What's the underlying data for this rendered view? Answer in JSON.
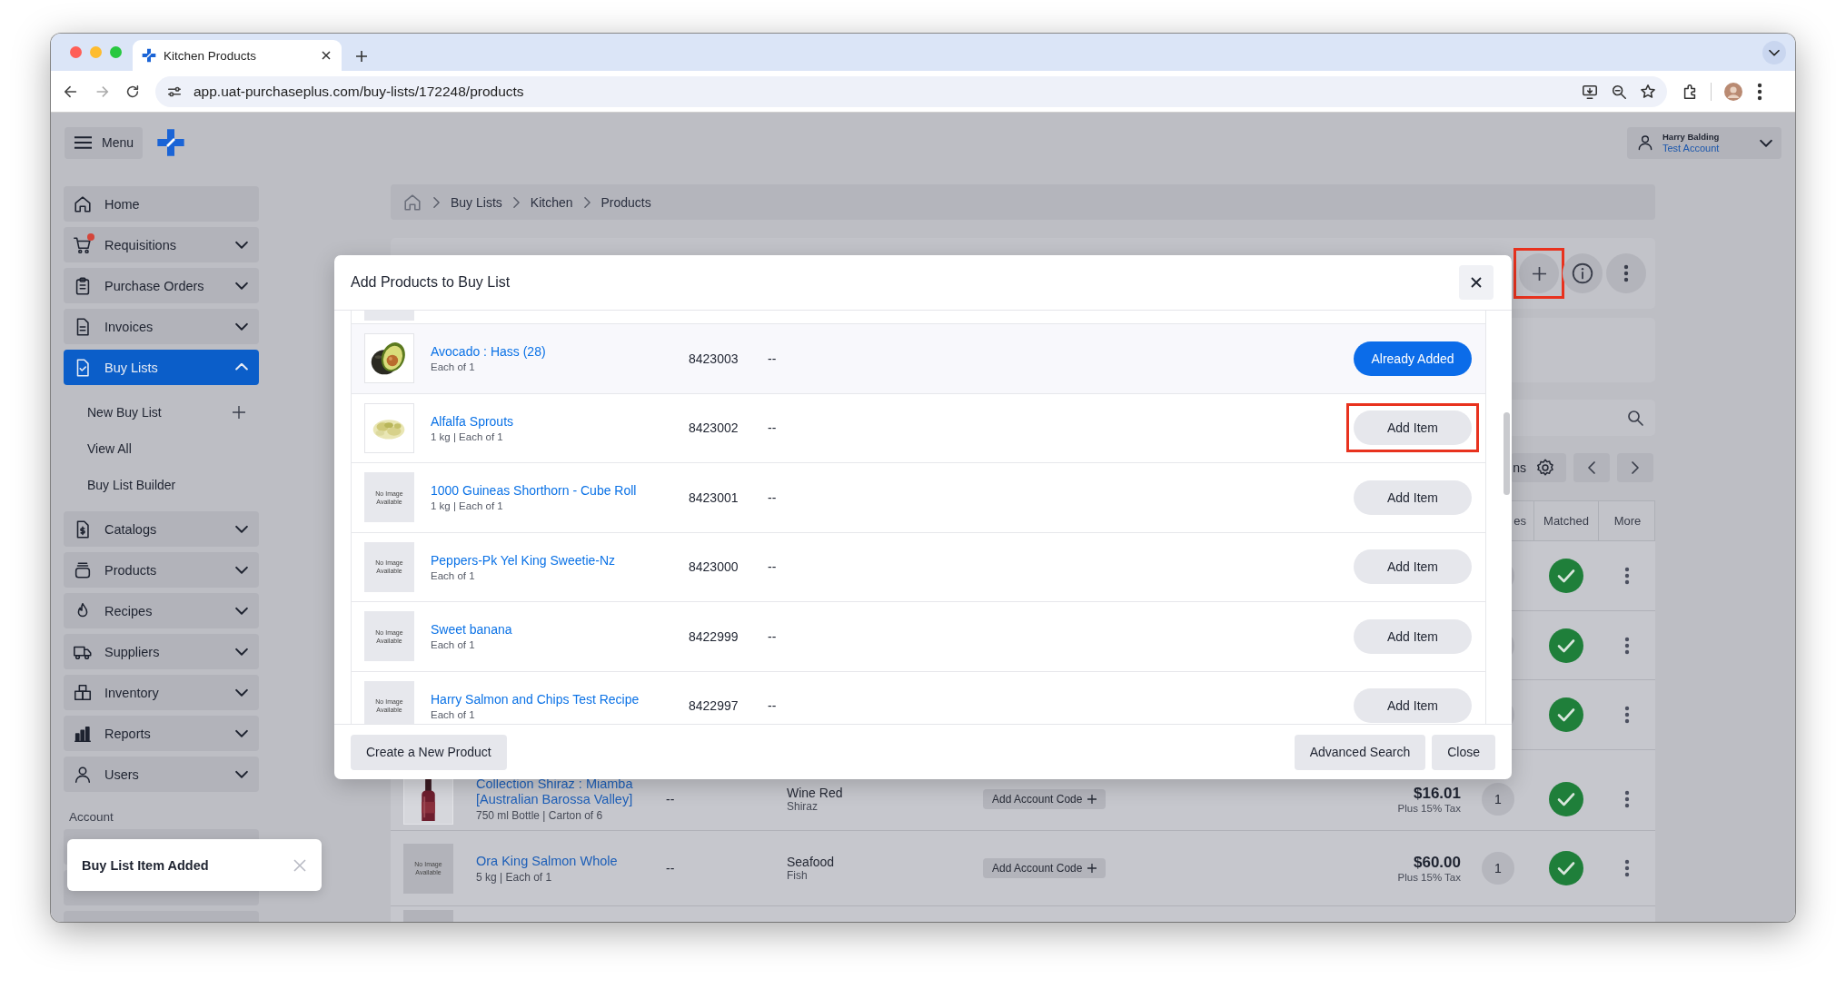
{
  "browser": {
    "tab_title": "Kitchen Products",
    "url": "app.uat-purchaseplus.com/buy-lists/172248/products"
  },
  "header": {
    "menu_label": "Menu",
    "user_name": "Harry Balding",
    "account_name": "Test Account"
  },
  "sidebar": {
    "items": [
      {
        "label": "Home",
        "kind": "link",
        "selected": false,
        "notification": false
      },
      {
        "label": "Requisitions",
        "kind": "group",
        "selected": false,
        "expanded": false,
        "notification": true
      },
      {
        "label": "Purchase Orders",
        "kind": "group",
        "selected": false,
        "expanded": false,
        "notification": false
      },
      {
        "label": "Invoices",
        "kind": "group",
        "selected": false,
        "expanded": false,
        "notification": false
      },
      {
        "label": "Buy Lists",
        "kind": "group",
        "selected": true,
        "expanded": true,
        "notification": false,
        "children": [
          {
            "label": "New Buy List",
            "kind": "add"
          },
          {
            "label": "View All",
            "kind": "link"
          },
          {
            "label": "Buy List Builder",
            "kind": "link"
          }
        ]
      },
      {
        "label": "Catalogs",
        "kind": "group",
        "selected": false,
        "expanded": false,
        "notification": false
      },
      {
        "label": "Products",
        "kind": "group",
        "selected": false,
        "expanded": false,
        "notification": false
      },
      {
        "label": "Recipes",
        "kind": "group",
        "selected": false,
        "expanded": false,
        "notification": false
      },
      {
        "label": "Suppliers",
        "kind": "group",
        "selected": false,
        "expanded": false,
        "notification": false
      },
      {
        "label": "Inventory",
        "kind": "group",
        "selected": false,
        "expanded": false,
        "notification": false
      },
      {
        "label": "Reports",
        "kind": "group",
        "selected": false,
        "expanded": false,
        "notification": false
      },
      {
        "label": "Users",
        "kind": "group",
        "selected": false,
        "expanded": false,
        "notification": false
      }
    ],
    "section_label": "Account"
  },
  "breadcrumb": [
    "Buy Lists",
    "Kitchen",
    "Products"
  ],
  "page": {
    "add_button_highlighted": true,
    "columns_button": "ns",
    "table": {
      "columns": [
        "es",
        "Matched",
        "More"
      ],
      "rows": [
        {
          "kind": "covered",
          "matched": true
        },
        {
          "kind": "covered",
          "matched": true
        },
        {
          "kind": "covered",
          "matched": true
        },
        {
          "kind": "full",
          "name": "Collection Shiraz : Miamba [Australian Barossa Valley]",
          "details": "750 ml Bottle | Carton of 6",
          "code": "--",
          "category": "Wine Red",
          "subcategory": "Shiraz",
          "account_code": "Add Account Code",
          "price": "$16.01",
          "tax": "Plus 15% Tax",
          "quantity": "1",
          "matched": true
        },
        {
          "kind": "full",
          "image": {
            "kind": "placeholder",
            "text": "No Image Available"
          },
          "name": "Ora King Salmon Whole",
          "details": "5 kg | Each of 1",
          "code": "--",
          "category": "Seafood",
          "subcategory": "Fish",
          "account_code": "Add Account Code",
          "price": "$60.00",
          "tax": "Plus 15% Tax",
          "quantity": "1",
          "matched": true
        }
      ]
    }
  },
  "modal": {
    "title": "Add Products to Buy List",
    "items": [
      {
        "name": "Avocado : Hass (28)",
        "details": "Each of 1",
        "code": "8423003",
        "extra": "--",
        "action": "Already Added",
        "added": true,
        "highlighted": false
      },
      {
        "name": "Alfalfa Sprouts",
        "details": "1 kg | Each of 1",
        "code": "8423002",
        "extra": "--",
        "action": "Add Item",
        "added": false,
        "highlighted": true
      },
      {
        "image": {
          "kind": "placeholder",
          "text": "No Image Available"
        },
        "name": "1000 Guineas Shorthorn - Cube Roll",
        "details": "1 kg | Each of 1",
        "code": "8423001",
        "extra": "--",
        "action": "Add Item",
        "added": false,
        "highlighted": false
      },
      {
        "image": {
          "kind": "placeholder",
          "text": "No Image Available"
        },
        "name": "Peppers-Pk Yel King Sweetie-Nz",
        "details": "Each of 1",
        "code": "8423000",
        "extra": "--",
        "action": "Add Item",
        "added": false,
        "highlighted": false
      },
      {
        "image": {
          "kind": "placeholder",
          "text": "No Image Available"
        },
        "name": "Sweet banana",
        "details": "Each of 1",
        "code": "8422999",
        "extra": "--",
        "action": "Add Item",
        "added": false,
        "highlighted": false
      },
      {
        "image": {
          "kind": "placeholder",
          "text": "No Image Available"
        },
        "name": "Harry Salmon and Chips Test Recipe",
        "details": "Each of 1",
        "code": "8422997",
        "extra": "--",
        "action": "Add Item",
        "added": false,
        "highlighted": false
      }
    ],
    "footer_left": "Create a New Product",
    "footer_right": [
      "Advanced Search",
      "Close"
    ]
  },
  "toast": {
    "message": "Buy List Item Added"
  }
}
